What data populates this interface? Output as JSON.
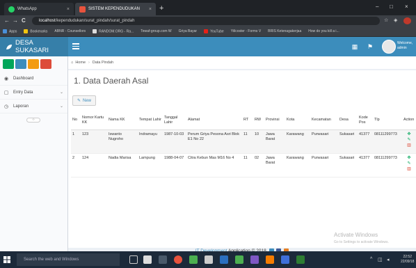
{
  "browser": {
    "tabs": [
      {
        "label": "WhatsApp",
        "close": "×",
        "color": "#25d366"
      },
      {
        "label": "SISTEM KEPENDUDUKAN",
        "close": "×",
        "color": "#e8533d"
      }
    ],
    "new_tab": "+",
    "window_controls": [
      "–",
      "□",
      "×"
    ],
    "nav": {
      "back": "←",
      "forward": "→",
      "reload": "C"
    },
    "url_host": "localhost",
    "url_path": "/kependudukan/surat_pindah/surat_pindah",
    "bookmarks": [
      "Apps",
      "Bookmarks",
      "ABNR - Counsellors",
      "RANDOM.ORG - Ra...",
      "Tewaf-group.com W",
      "Griya Bayar",
      "YouTube",
      "Yiilcoster - Forms V",
      "BRIS Ketenagakerjaa",
      "How do you kill a i..."
    ]
  },
  "app": {
    "brand": "DESA SUKASARI",
    "user_line1": "Welcome,",
    "user_line2": "admin",
    "colors": {
      "header": "#3c8dbc",
      "logo_bg": "#367fa9"
    }
  },
  "sidebar": {
    "quick_buttons": [
      "#00a65a",
      "#3c8dbc",
      "#f39c12",
      "#dd4b39"
    ],
    "items": [
      {
        "label": "Dashboard",
        "icon": "dashboard-icon",
        "glyph": "◉"
      },
      {
        "label": "Entry Data",
        "icon": "file-icon",
        "glyph": "▢",
        "chevron": "⌄"
      },
      {
        "label": "Laporan",
        "icon": "clock-icon",
        "glyph": "◷",
        "chevron": "⌄"
      }
    ],
    "collapse": "‹›"
  },
  "main": {
    "breadcrumb_home": "Home",
    "breadcrumb_current": "Data Pindah",
    "title": "1. Data Daerah Asal",
    "new_button": "New",
    "columns": [
      "No",
      "Nomor Kartu KK",
      "Nama KK",
      "Tempat Lahir",
      "Tanggal Lahir",
      "Alamat",
      "RT",
      "RW",
      "Provinsi",
      "Kota",
      "Kecamatan",
      "Desa",
      "Kode Pos",
      "Tlp",
      "Action"
    ],
    "rows": [
      [
        "1",
        "123",
        "Iswanto Nugroho",
        "Indramayu",
        "1987-10-03",
        "Perum Griya Pesona Asri Blok E1 No 22",
        "11",
        "10",
        "Jawa Barat",
        "Karawang",
        "Purwasari",
        "Sukasari",
        "41377",
        "08111299773"
      ],
      [
        "2",
        "124",
        "Nadia Marisa",
        "Lampung",
        "1988-04-07",
        "Citra Kebun Mas M16 No 4",
        "11",
        "02",
        "Jawa Barat",
        "Karawang",
        "Purwasari",
        "Sukasari",
        "41377",
        "08111299773"
      ]
    ],
    "actions": [
      "✥",
      "✎",
      "🗑"
    ]
  },
  "footer": {
    "brand": "IT Development",
    "text": " Application © 2018"
  },
  "watermark": {
    "line1": "Activate Windows",
    "line2": "Go to Settings to activate Windows."
  },
  "taskbar": {
    "search": "Search the web and Windows",
    "time": "22:52",
    "date": "22/09/18"
  }
}
